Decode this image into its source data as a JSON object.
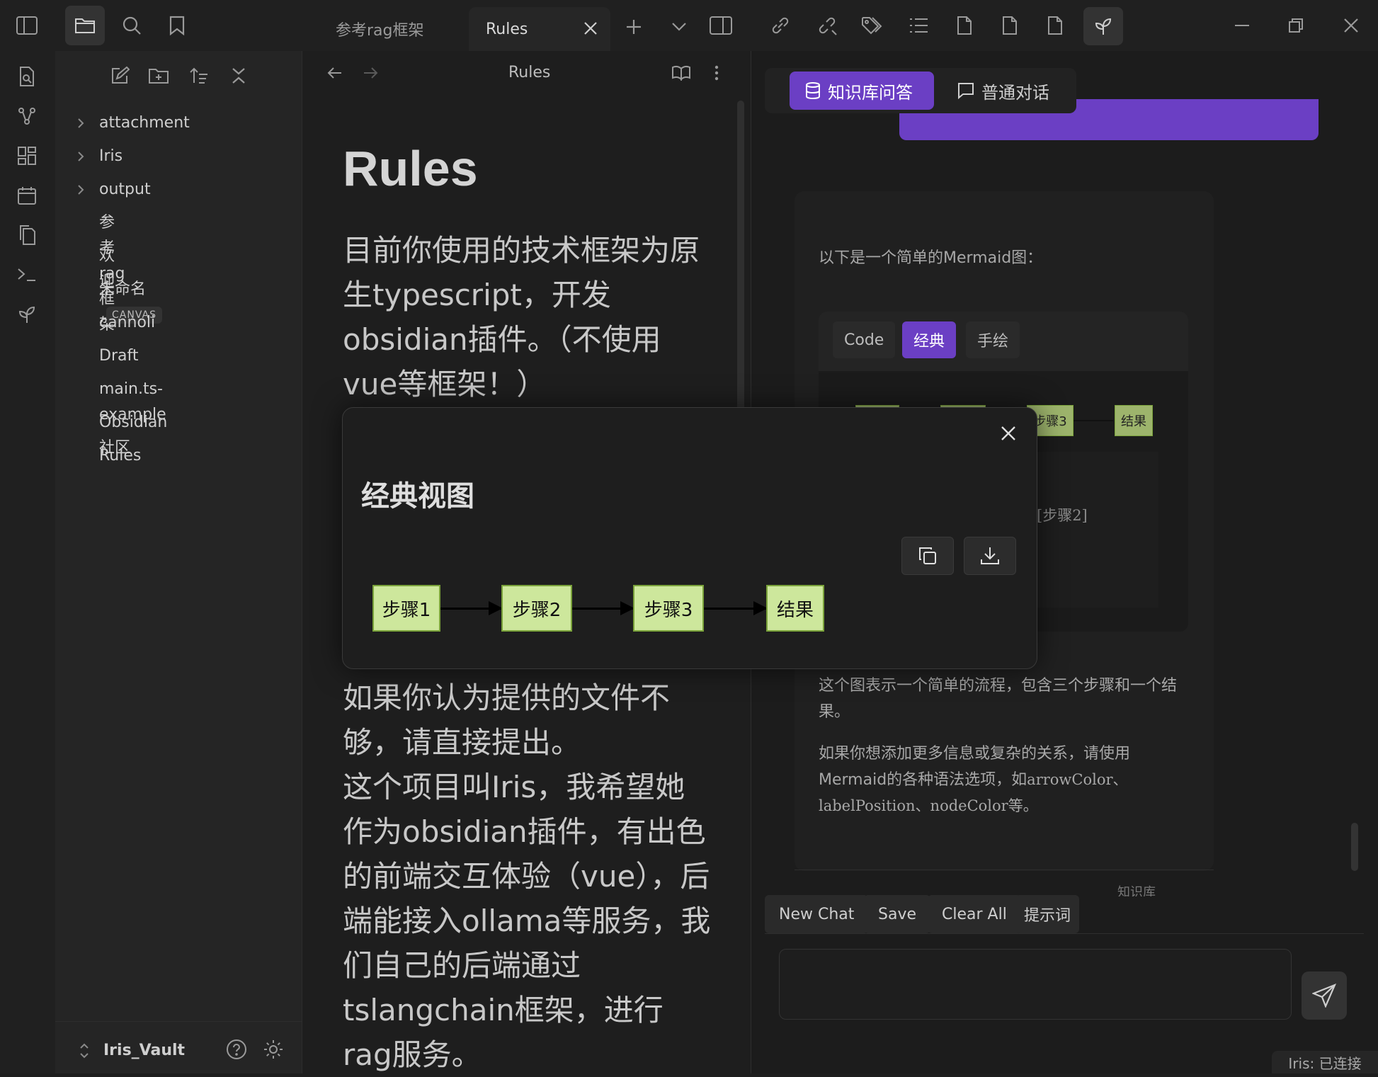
{
  "tabs": [
    {
      "label": "参考rag框架"
    },
    {
      "label": "Rules"
    }
  ],
  "sidebar": {
    "items": [
      {
        "label": "attachment"
      },
      {
        "label": "Iris"
      },
      {
        "label": "output"
      },
      {
        "label": "参考rag框架"
      },
      {
        "label": "欢迎"
      },
      {
        "label": "未命名",
        "badge": "CANVAS"
      },
      {
        "label": "cannoli"
      },
      {
        "label": "Draft"
      },
      {
        "label": "main.ts-example"
      },
      {
        "label": "Obsidian社区"
      },
      {
        "label": "Rules"
      }
    ],
    "vault_name": "Iris_Vault"
  },
  "editor": {
    "title": "Rules",
    "heading": "Rules",
    "para1": "目前你使用的技术框架为原生typescript，开发obsidian插件。（不使用vue等框架！）",
    "para2": "如果你认为提供的文件不够，请直接提出。",
    "para3": "这个项目叫Iris，我希望她作为obsidian插件，有出色的前端交互体验（vue），后端能接入ollama等服务，我们自己的后端通过tslangchain框架，进行rag服务。"
  },
  "chat": {
    "mode_kb": "知识库问答",
    "mode_chat": "普通对话",
    "intro": "以下是一个简单的Mermaid图：",
    "mermaid_tabs": [
      "Code",
      "经典",
      "手绘"
    ],
    "mermaid_nodes_bg": [
      "步骤3",
      "结果"
    ],
    "mermaid_code_fragment": "[步骤2]",
    "desc1": "这个图表示一个简单的流程，包含三个步骤和一个结果。",
    "desc2_prefix": "如果你想添加更多信息或复杂的关系，请使用Mermaid的各种语法选项，如",
    "desc2_code": "arrowColor、labelPosition、nodeColor等。",
    "kb_tag": "知识库",
    "actions": {
      "new_chat": "New Chat",
      "save": "Save",
      "clear": "Clear All",
      "prompts": "提示词"
    },
    "status": "Iris: 已连接"
  },
  "modal": {
    "title": "经典视图",
    "nodes": [
      "步骤1",
      "步骤2",
      "步骤3",
      "结果"
    ]
  },
  "colors": {
    "accent": "#6b3fc4",
    "node_fill": "#cde79c",
    "node_border": "#7aa23a"
  }
}
